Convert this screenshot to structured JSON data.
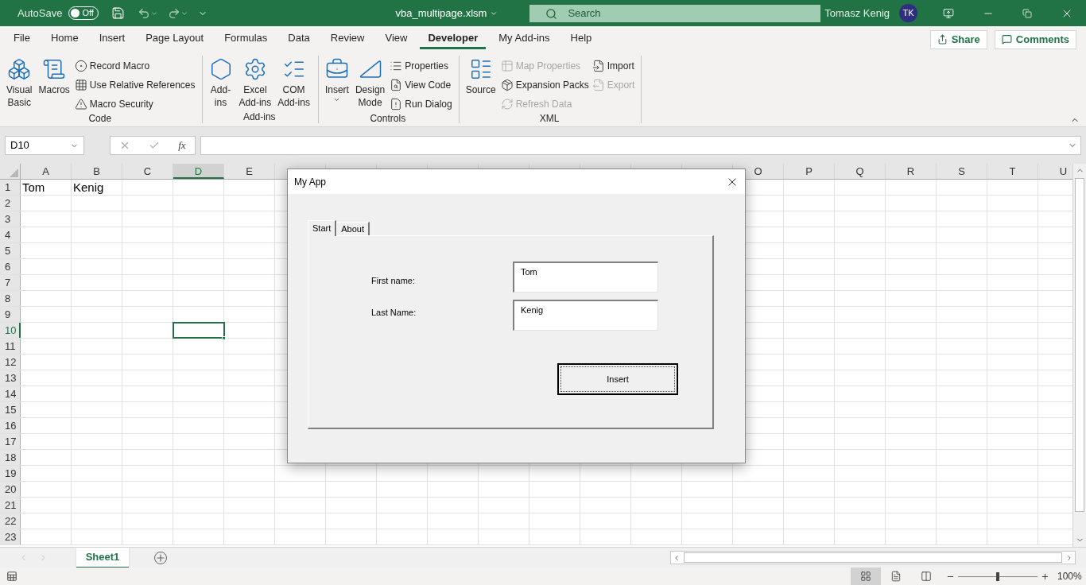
{
  "title_bar": {
    "autosave_label": "AutoSave",
    "autosave": {
      "on": false,
      "label": "Off"
    },
    "file_name": "vba_multipage.xlsm",
    "search": {
      "placeholder": "Search"
    },
    "user_name": "Tomasz Kenig",
    "avatar_initials": "TK"
  },
  "menu_tabs": [
    {
      "label": "File",
      "selected": false
    },
    {
      "label": "Home",
      "selected": false
    },
    {
      "label": "Insert",
      "selected": false
    },
    {
      "label": "Page Layout",
      "selected": false
    },
    {
      "label": "Formulas",
      "selected": false
    },
    {
      "label": "Data",
      "selected": false
    },
    {
      "label": "Review",
      "selected": false
    },
    {
      "label": "View",
      "selected": false
    },
    {
      "label": "Developer",
      "selected": true
    },
    {
      "label": "My Add-ins",
      "selected": false
    },
    {
      "label": "Help",
      "selected": false
    }
  ],
  "share_button": "Share",
  "comments_button": "Comments",
  "ribbon_groups": [
    {
      "label": "Code",
      "columns": [
        {
          "kind": "large",
          "lines": [
            "Visual",
            "Basic"
          ],
          "disabled": false
        },
        {
          "kind": "large",
          "lines": [
            "Macros"
          ],
          "disabled": false
        },
        {
          "kind": "stack",
          "items": [
            {
              "label": "Record Macro",
              "disabled": false
            },
            {
              "label": "Use Relative References",
              "disabled": false
            },
            {
              "label": "Macro Security",
              "disabled": false
            }
          ]
        }
      ]
    },
    {
      "label": "Add-ins",
      "columns": [
        {
          "kind": "large",
          "lines": [
            "Add-",
            "ins"
          ],
          "disabled": false
        },
        {
          "kind": "large",
          "lines": [
            "Excel",
            "Add-ins"
          ],
          "disabled": false
        },
        {
          "kind": "large",
          "lines": [
            "COM",
            "Add-ins"
          ],
          "disabled": false
        }
      ]
    },
    {
      "label": "Controls",
      "columns": [
        {
          "kind": "large",
          "lines": [
            "Insert"
          ],
          "disabled": false,
          "dropdown": true
        },
        {
          "kind": "large",
          "lines": [
            "Design",
            "Mode"
          ],
          "disabled": false
        },
        {
          "kind": "stack",
          "items": [
            {
              "label": "Properties",
              "disabled": false
            },
            {
              "label": "View Code",
              "disabled": false
            },
            {
              "label": "Run Dialog",
              "disabled": false
            }
          ]
        }
      ]
    },
    {
      "label": "XML",
      "columns": [
        {
          "kind": "large",
          "lines": [
            "Source"
          ],
          "disabled": false
        },
        {
          "kind": "stack",
          "items": [
            {
              "label": "Map Properties",
              "disabled": true
            },
            {
              "label": "Expansion Packs",
              "disabled": false
            },
            {
              "label": "Refresh Data",
              "disabled": true
            }
          ]
        },
        {
          "kind": "stack",
          "items": [
            {
              "label": "Import",
              "disabled": false
            },
            {
              "label": "Export",
              "disabled": true
            }
          ]
        }
      ]
    }
  ],
  "formula_bar": {
    "name_box": "D10",
    "function_label": "fx"
  },
  "sheet": {
    "columns_left": [
      {
        "label": "A",
        "selected": false
      },
      {
        "label": "B",
        "selected": false
      },
      {
        "label": "C",
        "selected": false
      },
      {
        "label": "D",
        "selected": true
      },
      {
        "label": "E",
        "selected": false
      }
    ],
    "columns_right": [
      {
        "label": "O",
        "selected": false
      },
      {
        "label": "P",
        "selected": false
      },
      {
        "label": "Q",
        "selected": false
      },
      {
        "label": "R",
        "selected": false
      },
      {
        "label": "S",
        "selected": false
      },
      {
        "label": "T",
        "selected": false
      },
      {
        "label": "U",
        "selected": false
      }
    ],
    "rows": [
      {
        "header": "1",
        "selected": false,
        "cells": [
          "Tom",
          "Kenig"
        ]
      },
      {
        "header": "2",
        "selected": false
      },
      {
        "header": "3",
        "selected": false
      },
      {
        "header": "4",
        "selected": false
      },
      {
        "header": "5",
        "selected": false
      },
      {
        "header": "6",
        "selected": false
      },
      {
        "header": "7",
        "selected": false
      },
      {
        "header": "8",
        "selected": false
      },
      {
        "header": "9",
        "selected": false
      },
      {
        "header": "10",
        "selected": true
      },
      {
        "header": "11",
        "selected": false
      },
      {
        "header": "12",
        "selected": false
      },
      {
        "header": "13",
        "selected": false
      },
      {
        "header": "14",
        "selected": false
      },
      {
        "header": "15",
        "selected": false
      },
      {
        "header": "16",
        "selected": false
      },
      {
        "header": "17",
        "selected": false
      },
      {
        "header": "18",
        "selected": false
      },
      {
        "header": "19",
        "selected": false
      },
      {
        "header": "20",
        "selected": false
      },
      {
        "header": "21",
        "selected": false
      },
      {
        "header": "22",
        "selected": false
      },
      {
        "header": "23",
        "selected": false
      }
    ]
  },
  "sheet_tabs": [
    {
      "label": "Sheet1",
      "selected": true
    }
  ],
  "status_bar": {
    "views": [
      {
        "selected": true
      },
      {
        "selected": false
      },
      {
        "selected": false
      }
    ],
    "zoom": {
      "level": 0.5,
      "reading": "100%"
    }
  },
  "dialog": {
    "title": "My App",
    "tabs": [
      {
        "label": "Start",
        "selected": true
      },
      {
        "label": "About",
        "selected": false
      }
    ],
    "fields": [
      {
        "label": "First name:",
        "value": "Tom"
      },
      {
        "label": "Last Name:",
        "value": "Kenig"
      }
    ],
    "button": "Insert"
  }
}
